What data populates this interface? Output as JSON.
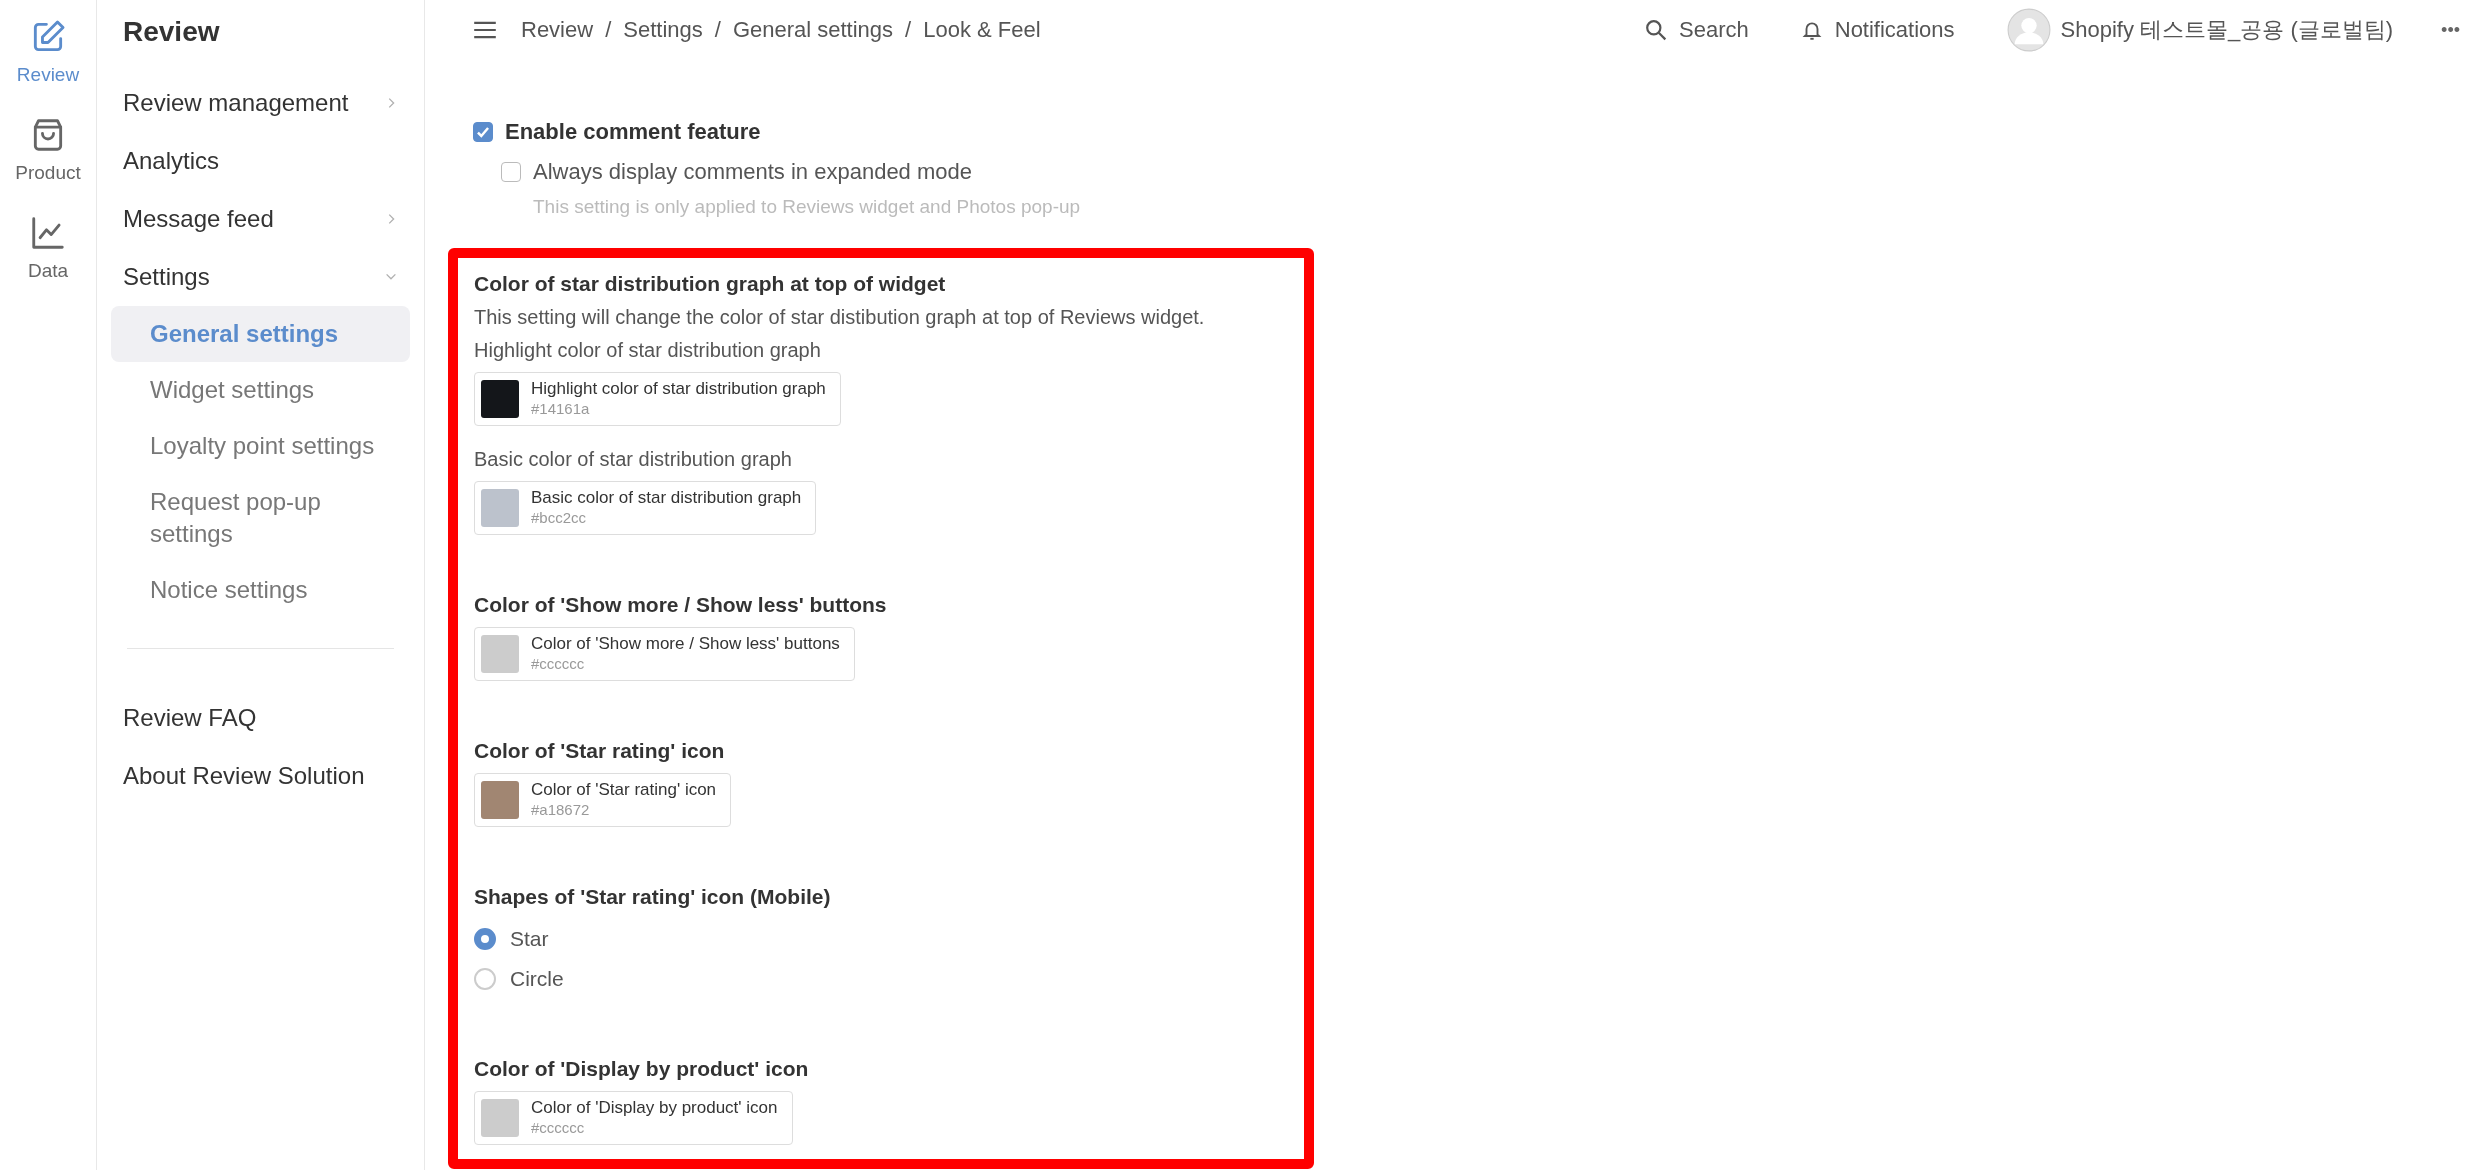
{
  "rail": [
    {
      "label": "Review",
      "kind": "edit",
      "selected": true
    },
    {
      "label": "Product",
      "kind": "bag",
      "selected": false
    },
    {
      "label": "Data",
      "kind": "chart",
      "selected": false
    }
  ],
  "sidebar": {
    "title": "Review",
    "items": [
      {
        "label": "Review management",
        "expanded": false
      },
      {
        "label": "Analytics"
      },
      {
        "label": "Message feed",
        "expanded": false
      },
      {
        "label": "Settings",
        "expanded": true,
        "children": [
          {
            "label": "General settings",
            "selected": true
          },
          {
            "label": "Widget settings",
            "selected": false
          },
          {
            "label": "Loyalty point settings",
            "selected": false
          },
          {
            "label": "Request pop-up settings",
            "selected": false
          },
          {
            "label": "Notice settings",
            "selected": false
          }
        ]
      }
    ],
    "footer_items": [
      {
        "label": "Review FAQ"
      },
      {
        "label": "About Review Solution"
      }
    ]
  },
  "breadcrumb": [
    "Review",
    "Settings",
    "General settings",
    "Look & Feel"
  ],
  "breadcrumb_separator": "/",
  "top_actions": [
    {
      "label": "Search",
      "kind": "search"
    },
    {
      "label": "Notifications",
      "kind": "bell"
    }
  ],
  "account": {
    "name": "Shopify 테스트몰_공용 (글로벌팀)"
  },
  "more_menu": "•••",
  "comments": {
    "enable": {
      "label": "Enable comment feature",
      "checked": true
    },
    "expanded_mode": {
      "label": "Always display comments in expanded mode",
      "checked": false
    },
    "hint": "This setting is only applied to Reviews widget and Photos pop-up"
  },
  "sections": [
    {
      "kind": "color",
      "title": "Color of star distribution graph at top of widget",
      "description": "This setting will change the color of star distibution graph at top of Reviews widget.",
      "fields": [
        {
          "label": "Highlight color of star distribution graph",
          "swatch_label": "Highlight color of star distribution graph",
          "value": "#14161a",
          "color": "#14161a"
        },
        {
          "label": "Basic color of star distribution graph",
          "swatch_label": "Basic color of star distribution graph",
          "value": "#bcc2cc",
          "color": "#bcc2cc"
        }
      ]
    },
    {
      "kind": "color",
      "title": "Color of 'Show more / Show less' buttons",
      "fields": [
        {
          "swatch_label": "Color of 'Show more / Show less' buttons",
          "value": "#cccccc",
          "color": "#cccccc"
        }
      ]
    },
    {
      "kind": "color",
      "title": "Color of 'Star rating' icon",
      "fields": [
        {
          "swatch_label": "Color of 'Star rating' icon",
          "value": "#a18672",
          "color": "#a18672"
        }
      ]
    },
    {
      "kind": "radio",
      "title": "Shapes of 'Star rating' icon (Mobile)",
      "options": [
        {
          "label": "Star",
          "selected": true
        },
        {
          "label": "Circle",
          "selected": false
        }
      ]
    },
    {
      "kind": "color",
      "title": "Color of 'Display by product' icon",
      "fields": [
        {
          "swatch_label": "Color of 'Display by product' icon",
          "value": "#cccccc",
          "color": "#cccccc"
        }
      ]
    }
  ]
}
